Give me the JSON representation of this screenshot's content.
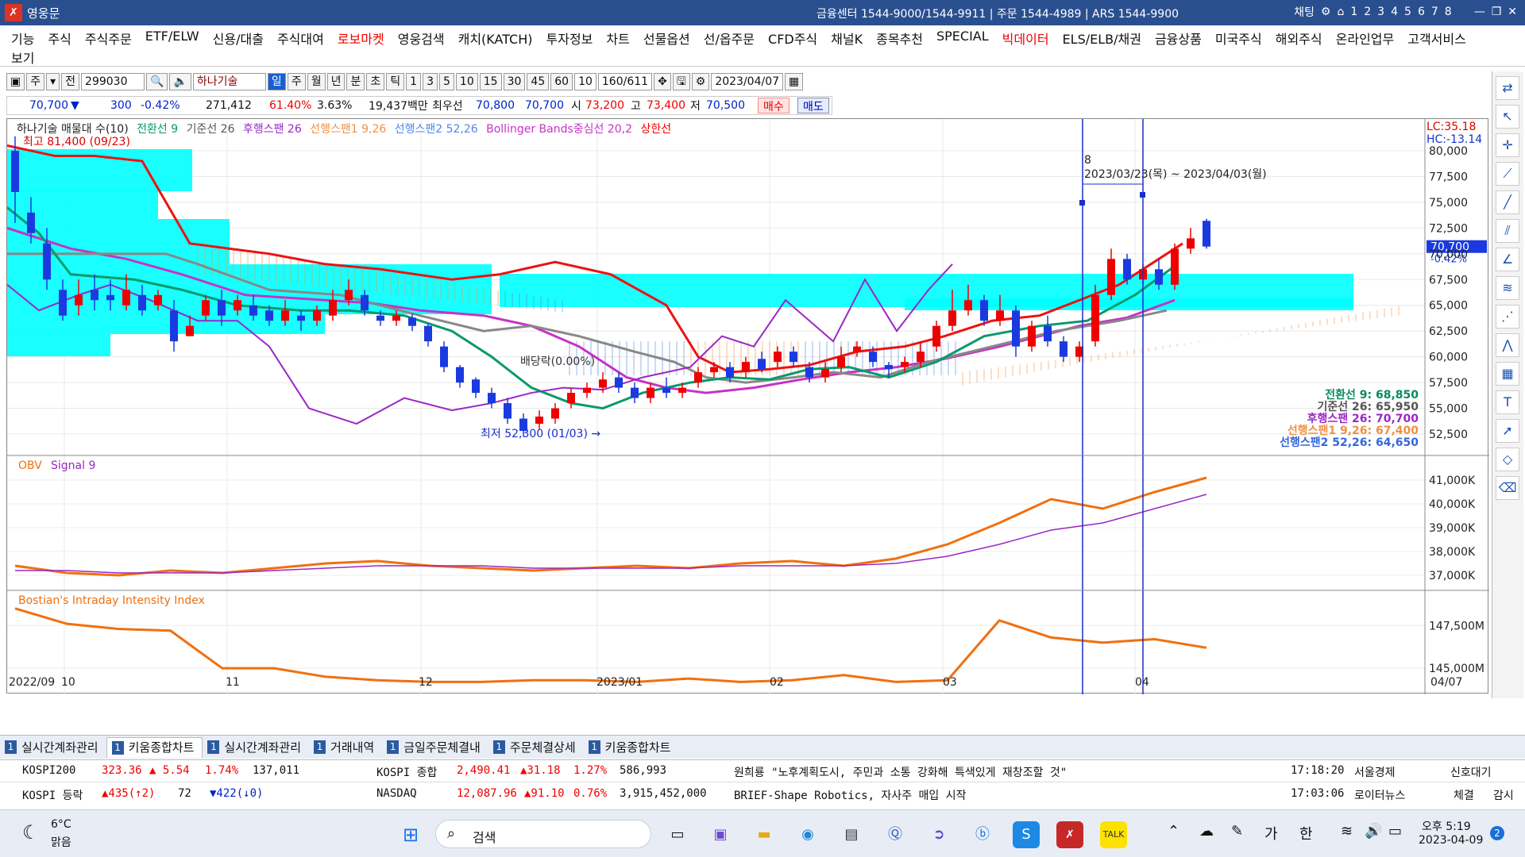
{
  "titlebar": {
    "title": "영웅문",
    "center": "금융센터 1544-9000/1544-9911 | 주문 1544-4989 | ARS 1544-9900",
    "chart_label": "채팅",
    "numbers": [
      "1",
      "2",
      "3",
      "4",
      "5",
      "6",
      "7",
      "8"
    ]
  },
  "menu": {
    "items": [
      "기능",
      "주식",
      "주식주문",
      "ETF/ELW",
      "신용/대출",
      "주식대여",
      "로보마켓",
      "영웅검색",
      "캐치(KATCH)",
      "투자정보",
      "차트",
      "선물옵션",
      "선/옵주문",
      "CFD주식",
      "채널K",
      "종목추천",
      "SPECIAL",
      "빅데이터",
      "ELS/ELB/채권",
      "금융상품",
      "미국주식",
      "해외주식",
      "온라인업무",
      "고객서비스"
    ],
    "red_items": [
      "로보마켓",
      "빅데이터"
    ],
    "second_row": "보기"
  },
  "toolbar": {
    "type": "주",
    "prev": "전",
    "code": "299030",
    "stock_name": "하나기술",
    "periods": [
      "일",
      "주",
      "월",
      "년",
      "분",
      "초",
      "틱"
    ],
    "active_period": "일",
    "intervals": [
      "1",
      "3",
      "5",
      "10",
      "15",
      "30",
      "45",
      "60"
    ],
    "count_sel": "10",
    "range": "160",
    "total": "/611",
    "date": "2023/04/07"
  },
  "pricebar": {
    "price": "70,700",
    "change": "300",
    "pct": "-0.42%",
    "volume": "271,412",
    "ratio": "61.40%",
    "turnover": "3.63%",
    "amount": "19,437백만",
    "best_ask_label": "최우선",
    "ask": "70,800",
    "bid": "70,700",
    "open_label": "시",
    "open": "73,200",
    "high_label": "고",
    "high": "73,400",
    "low_label": "저",
    "low": "70,500",
    "buy": "매수",
    "sell": "매도"
  },
  "chart": {
    "legend": [
      {
        "text": "하나기술 매물대 수(10)",
        "color": "#222"
      },
      {
        "text": "전환선 9",
        "color": "#0a9a6a"
      },
      {
        "text": "기준선 26",
        "color": "#555"
      },
      {
        "text": "후행스팬 26",
        "color": "#9b27c5"
      },
      {
        "text": "선행스팬1 9,26",
        "color": "#f29043"
      },
      {
        "text": "선행스팬2 52,26",
        "color": "#4f86e8"
      },
      {
        "text": "Bollinger Bands중심선 20,2",
        "color": "#c633c6"
      },
      {
        "text": "상한선",
        "color": "#e00"
      }
    ],
    "high_label": "최고 81,400 (09/23)",
    "low_label": "최저 52,300 (01/03)",
    "range_label": "2023/03/23(목) ~ 2023/04/03(월)",
    "range_count": "8",
    "lc": "LC:35.18",
    "hc": "HC:-13.14",
    "price_ticks": [
      "80,000",
      "77,500",
      "75,000",
      "72,500",
      "70,000",
      "67,500",
      "65,000",
      "62,500",
      "60,000",
      "57,500",
      "55,000",
      "52,500"
    ],
    "current_price_tag": "70,700",
    "current_pct_tag": "-0.42%",
    "right_labels": [
      {
        "text": "전환선 9: 68,850",
        "color": "#0a8a5a"
      },
      {
        "text": "기준선 26: 65,950",
        "color": "#555"
      },
      {
        "text": "후행스팬 26: 70,700",
        "color": "#9b27c5"
      },
      {
        "text": "선행스팬1 9,26: 67,400",
        "color": "#f29043"
      },
      {
        "text": "선행스팬2 52,26: 64,650",
        "color": "#3366dd"
      }
    ],
    "annot_mid": "배당락(0.00%)",
    "obv_title": "OBV",
    "obv_signal": "Signal 9",
    "obv_ticks": [
      "41,000K",
      "40,000K",
      "39,000K",
      "38,000K",
      "37,000K"
    ],
    "bii_title": "Bostian's Intraday Intensity Index",
    "bii_ticks": [
      "147,500M",
      "145,000M"
    ],
    "x_labels": [
      "2022/09",
      "10",
      "11",
      "12",
      "2023/01",
      "02",
      "03",
      "04",
      "04/07"
    ]
  },
  "chart_data": [
    {
      "type": "line",
      "title": "",
      "series": [
        {
          "name": "OBV",
          "values": [
            37.4,
            37.1,
            37.0,
            37.2,
            37.1,
            37.3,
            37.5,
            37.6,
            37.4,
            37.3,
            37.2,
            37.3,
            37.4,
            37.3,
            37.5,
            37.6,
            37.4,
            37.7,
            38.3,
            39.2,
            40.2,
            39.8,
            40.5,
            41.1
          ]
        },
        {
          "name": "Signal 9",
          "values": [
            37.2,
            37.2,
            37.1,
            37.1,
            37.1,
            37.2,
            37.3,
            37.4,
            37.4,
            37.4,
            37.3,
            37.3,
            37.3,
            37.3,
            37.4,
            37.4,
            37.4,
            37.5,
            37.8,
            38.3,
            38.9,
            39.2,
            39.8,
            40.4
          ]
        }
      ],
      "ylabel": "",
      "ylim": [
        36.5,
        41.5
      ]
    },
    {
      "type": "line",
      "title": "Bostian's Intraday Intensity Index",
      "series": [
        {
          "name": "Bostian's Intraday Intensity Index",
          "values": [
            148.5,
            147.6,
            147.3,
            147.2,
            145.0,
            145.0,
            144.5,
            144.3,
            144.2,
            144.2,
            144.3,
            144.3,
            144.2,
            144.4,
            144.2,
            144.3,
            144.6,
            144.2,
            144.3,
            147.8,
            146.8,
            146.5,
            146.7,
            146.2
          ]
        }
      ],
      "ylim": [
        143.8,
        149
      ]
    }
  ],
  "tabs": [
    {
      "num": "1",
      "label": "실시간계좌관리"
    },
    {
      "num": "1",
      "label": "키움종합차트"
    },
    {
      "num": "1",
      "label": "실시간계좌관리"
    },
    {
      "num": "1",
      "label": "거래내역"
    },
    {
      "num": "1",
      "label": "금일주문체결내"
    },
    {
      "num": "1",
      "label": "주문체결상세"
    },
    {
      "num": "1",
      "label": "키움종합차트"
    }
  ],
  "ticker": {
    "r1": {
      "n1": "KOSPI200",
      "v1": "323.36",
      "c1": "▲ 5.54",
      "p1": "1.74%",
      "q1": "137,011",
      "n2": "KOSPI 종합",
      "v2": "2,490.41",
      "c2": "▲31.18",
      "p2": "1.27%",
      "q2": "586,993",
      "news": "원희룡 \"노후계획도시, 주민과 소통 강화해 특색있게 재창조할 것\"",
      "time": "17:18:20",
      "src": "서울경제",
      "sig": "신호대기"
    },
    "r2": {
      "n1": "KOSPI 등락",
      "v1": "▲435(↑2)",
      "c1": "72",
      "p1": "▼422(↓0)",
      "n2": "NASDAQ",
      "v2": "12,087.96",
      "c2": "▲91.10",
      "p2": "0.76%",
      "q2": "3,915,452,000",
      "news": "BRIEF-Shape Robotics, 자사주 매입 시작",
      "time": "17:03:06",
      "src": "로이터뉴스",
      "sig": "체결",
      "sig2": "감시"
    }
  },
  "taskbar": {
    "temp": "6°C",
    "weather": "맑음",
    "search": "검색",
    "time": "오후 5:19",
    "date": "2023-04-09",
    "lang1": "가",
    "lang2": "한",
    "badge": "2"
  }
}
